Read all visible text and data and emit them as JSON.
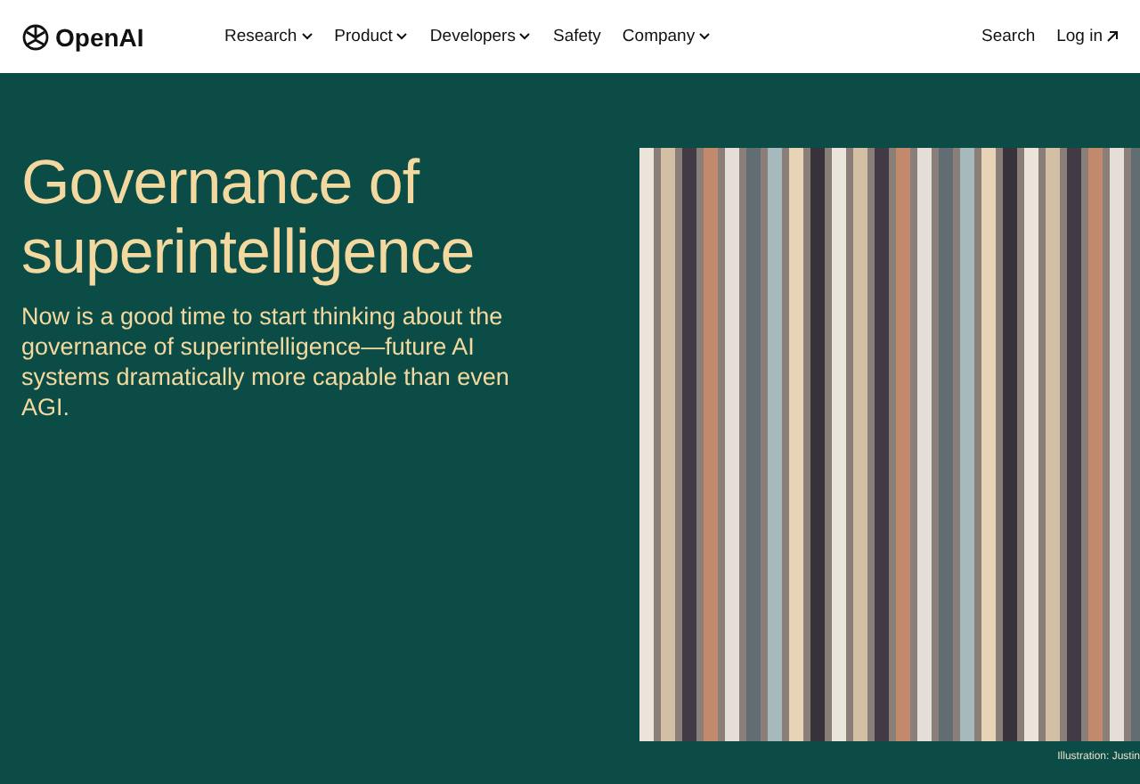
{
  "header": {
    "logo": "OpenAI",
    "nav": [
      {
        "label": "Research",
        "dropdown": true
      },
      {
        "label": "Product",
        "dropdown": true
      },
      {
        "label": "Developers",
        "dropdown": true
      },
      {
        "label": "Safety",
        "dropdown": false
      },
      {
        "label": "Company",
        "dropdown": true
      }
    ],
    "search": "Search",
    "login": "Log in"
  },
  "hero": {
    "title": "Governance of superintelligence",
    "summary": "Now is a good time to start thinking about the governance of superintelligence—future AI systems dramatically more capable than even AGI.",
    "caption": "Illustration: Justin"
  }
}
